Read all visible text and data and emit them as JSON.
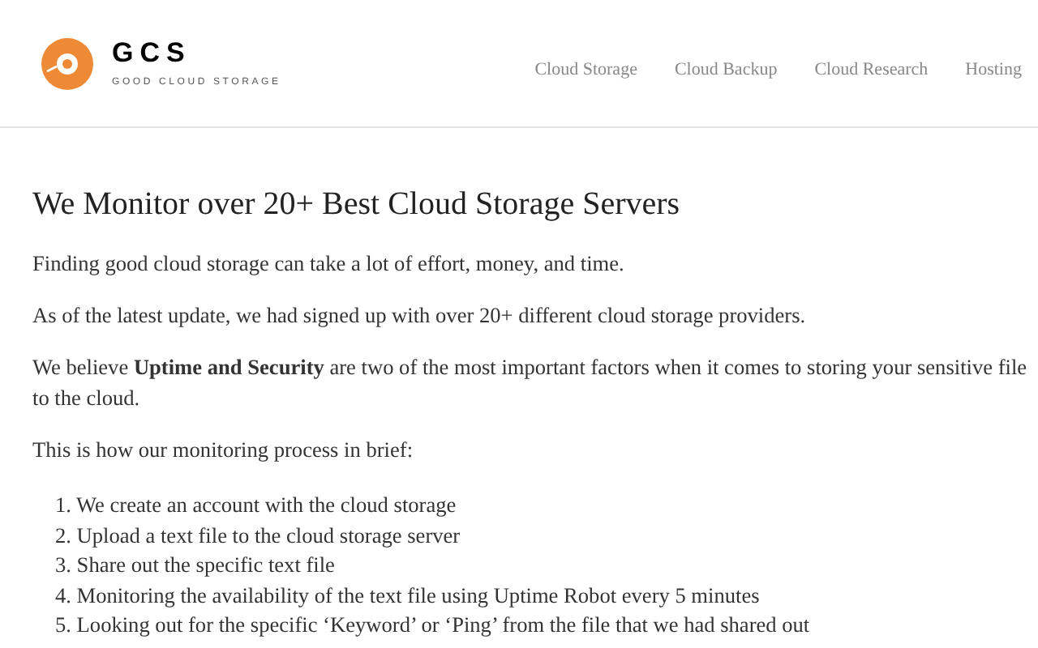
{
  "logo": {
    "name": "GCS",
    "tagline": "GOOD CLOUD STORAGE"
  },
  "nav": [
    "Cloud Storage",
    "Cloud Backup",
    "Cloud Research",
    "Hosting"
  ],
  "heading": "We Monitor over 20+ Best Cloud Storage Servers",
  "paragraphs": [
    {
      "lines": [
        "Finding good cloud storage can take a lot of effort, money, and time."
      ]
    },
    {
      "lines": [
        "As of the latest update, we had signed up with over 20+ different cloud storage providers."
      ]
    },
    {
      "lines": [
        "We believe **Uptime and Security** are two of the most important factors when it comes to storing your sensitive file",
        "to the cloud."
      ]
    },
    {
      "lines": [
        "This is how our monitoring process in brief:"
      ]
    }
  ],
  "steps": [
    {
      "number": "1.",
      "text": "We create an account with the cloud storage"
    },
    {
      "number": "2.",
      "text": "Upload a text file to the cloud storage server"
    },
    {
      "number": "3.",
      "text": "Share out the specific text file"
    },
    {
      "number": "4.",
      "text": "Monitoring the availability of the text file using Uptime Robot every 5 minutes"
    },
    {
      "number": "5.",
      "text": "Looking out for the specific ‘Keyword’ or ‘Ping’ from the file that we had shared out"
    }
  ]
}
